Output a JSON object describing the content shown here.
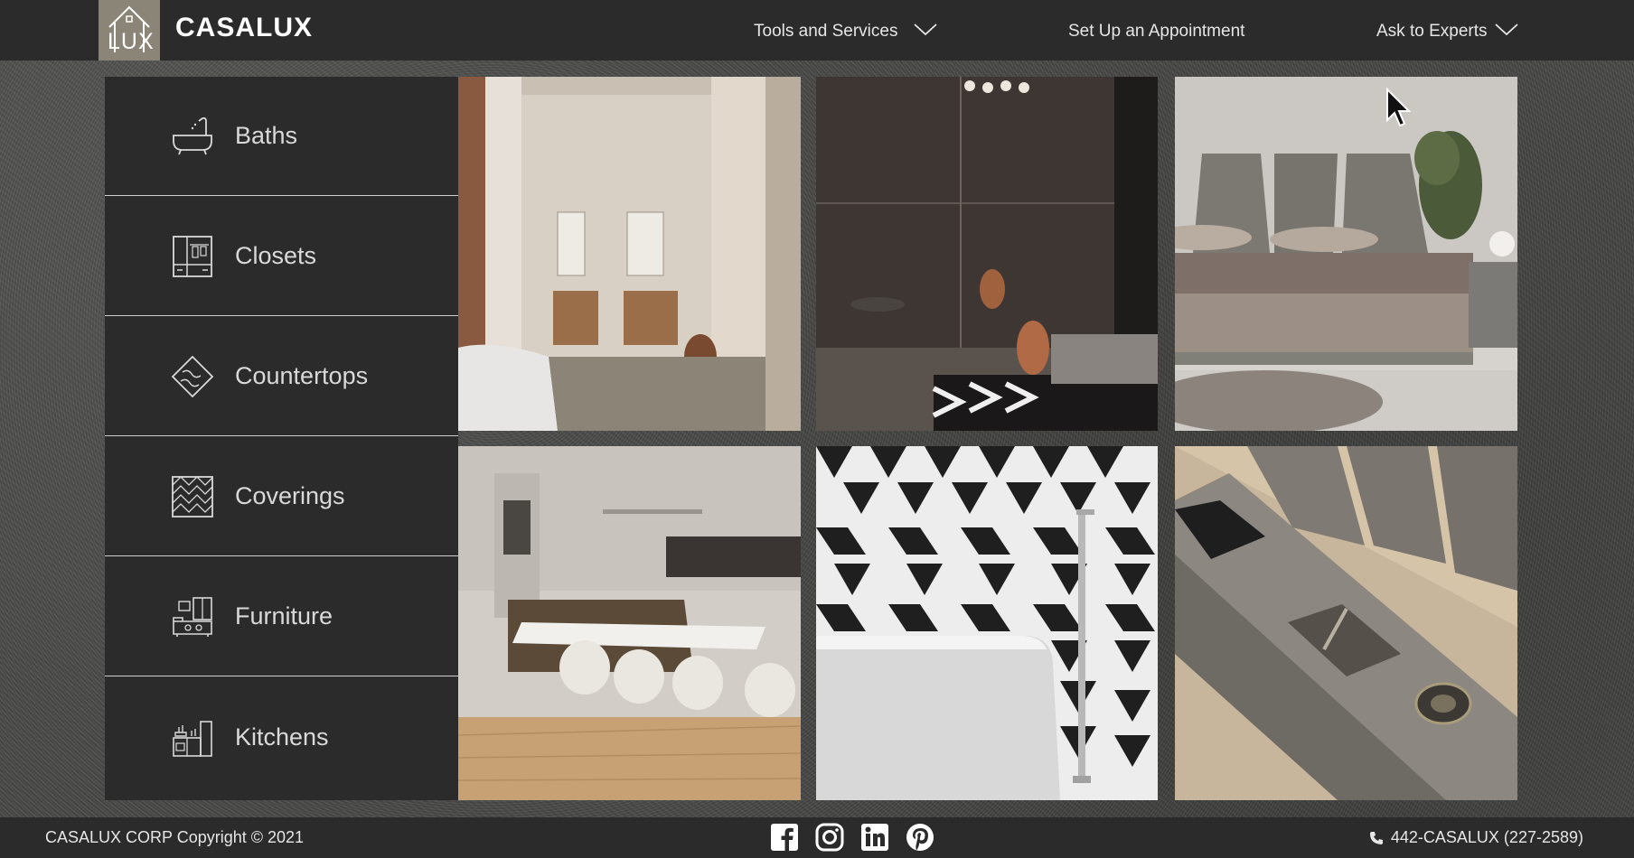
{
  "header": {
    "brand": "CASALUX",
    "logo_text": "LUX",
    "nav": [
      {
        "label": "Tools and Services"
      },
      {
        "label": "Set Up an Appointment"
      },
      {
        "label": "Ask to Experts"
      }
    ]
  },
  "sidebar": {
    "items": [
      {
        "label": "Baths",
        "icon": "bathtub-icon"
      },
      {
        "label": "Closets",
        "icon": "closet-icon"
      },
      {
        "label": "Countertops",
        "icon": "countertop-icon"
      },
      {
        "label": "Coverings",
        "icon": "coverings-icon"
      },
      {
        "label": "Furniture",
        "icon": "furniture-icon"
      },
      {
        "label": "Kitchens",
        "icon": "kitchen-icon"
      }
    ]
  },
  "gallery": {
    "tiles": [
      {
        "subject": "bedroom-with-bathroom"
      },
      {
        "subject": "glass-walk-in-closet"
      },
      {
        "subject": "bed-with-headboard"
      },
      {
        "subject": "kitchen-with-island"
      },
      {
        "subject": "bathtub-with-tile-wall"
      },
      {
        "subject": "kitchen-countertop-sink"
      }
    ]
  },
  "footer": {
    "copyright": "CASALUX CORP Copyright © 2021",
    "phone": "442-CASALUX (227-2589)",
    "social": [
      "facebook-icon",
      "instagram-icon",
      "linkedin-icon",
      "pinterest-icon"
    ]
  },
  "colors": {
    "bar": "#2b2b2b",
    "logo_bg": "#8a8576",
    "text": "#e6e6e6"
  }
}
